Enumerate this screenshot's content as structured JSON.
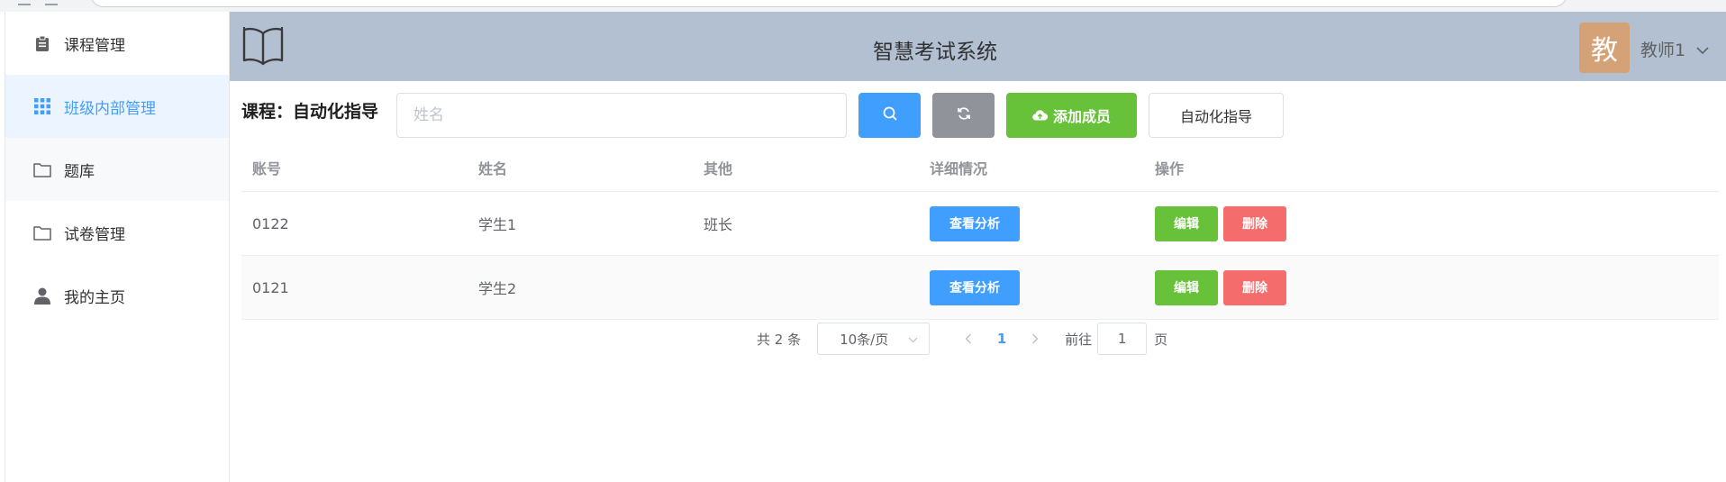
{
  "sidebar": {
    "items": [
      {
        "label": "课程管理",
        "icon": "clipboard-icon"
      },
      {
        "label": "班级内部管理",
        "icon": "grid-icon",
        "active": true
      },
      {
        "label": "题库",
        "icon": "folder-icon"
      },
      {
        "label": "试卷管理",
        "icon": "folder-icon"
      },
      {
        "label": "我的主页",
        "icon": "user-icon"
      }
    ]
  },
  "header": {
    "title": "智慧考试系统",
    "avatar_text": "教",
    "user_name": "教师1"
  },
  "toolbar": {
    "course_label": "课程：自动化指导",
    "search_placeholder": "姓名",
    "add_label": "添加成员",
    "course_button": "自动化指导"
  },
  "table": {
    "headers": [
      "账号",
      "姓名",
      "其他",
      "详细情况",
      "操作"
    ],
    "rows": [
      {
        "account": "0122",
        "name": "学生1",
        "other": "班长"
      },
      {
        "account": "0121",
        "name": "学生2",
        "other": ""
      }
    ],
    "analyze_label": "查看分析",
    "edit_label": "编辑",
    "delete_label": "删除"
  },
  "pagination": {
    "total": "共 2 条",
    "page_size": "10条/页",
    "current_page": "1",
    "goto_label": "前往",
    "goto_value": "1",
    "page_word": "页"
  },
  "colors": {
    "primary": "#409eff",
    "success": "#67c23a",
    "danger": "#f56c6c",
    "info": "#909399",
    "header_bg": "#b3c0d1",
    "avatar_bg": "#d4a276"
  }
}
